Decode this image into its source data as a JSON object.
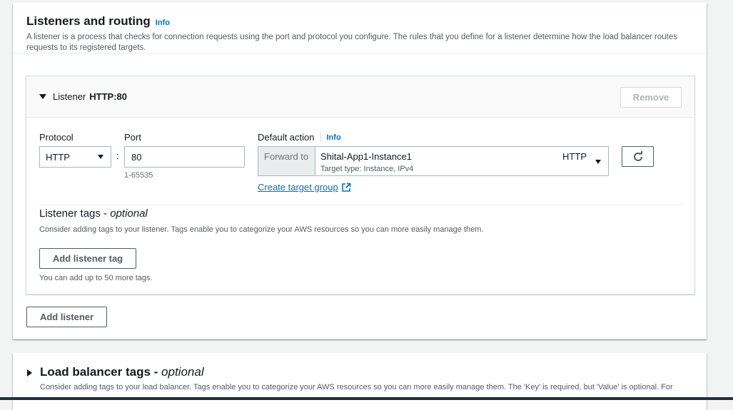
{
  "section": {
    "title": "Listeners and routing",
    "info": "Info",
    "description": "A listener is a process that checks for connection requests using the port and protocol you configure. The rules that you define for a listener determine how the load balancer routes requests to its registered targets."
  },
  "listener": {
    "label": "Listener",
    "name": "HTTP:80",
    "remove_label": "Remove",
    "protocol_label": "Protocol",
    "protocol_value": "HTTP",
    "colon": ":",
    "port_label": "Port",
    "port_value": "80",
    "port_hint": "1-65535",
    "default_action_label": "Default action",
    "default_action_info": "Info",
    "forward_to": "Forward to",
    "target_group_name": "Shital-App1-Instance1",
    "target_group_protocol": "HTTP",
    "target_type": "Target type: Instance, IPv4",
    "create_target_group": "Create target group",
    "tags_title": "Listener tags - ",
    "tags_optional": "optional",
    "tags_description": "Consider adding tags to your listener. Tags enable you to categorize your AWS resources so you can more easily manage them.",
    "add_tag_label": "Add listener tag",
    "tags_remaining": "You can add up to 50 more tags."
  },
  "add_listener_label": "Add listener",
  "lb_tags": {
    "title": "Load balancer tags - ",
    "optional": "optional",
    "description": "Consider adding tags to your load balancer. Tags enable you to categorize your AWS resources so you can more easily manage them. The 'Key' is required, but 'Value' is optional. For"
  },
  "colors": {
    "link": "#0073bb",
    "text": "#16191f",
    "muted": "#545b64"
  }
}
